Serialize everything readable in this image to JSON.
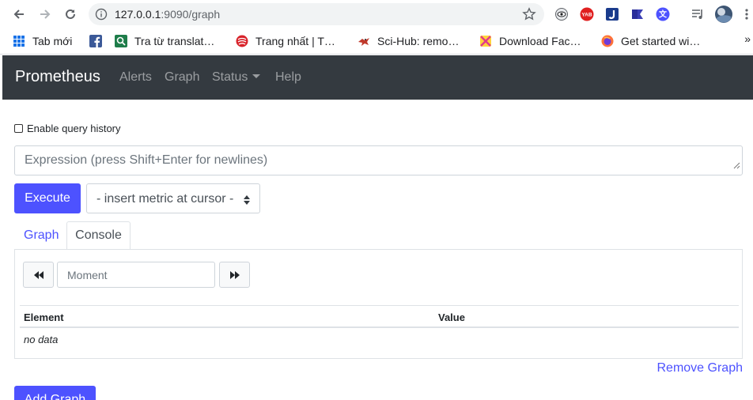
{
  "browser": {
    "url_host": "127.0.0.1",
    "url_rest": ":9090/graph",
    "bookmarks": [
      {
        "label": "Tab mới"
      },
      {
        "label": ""
      },
      {
        "label": "Tra từ translat…"
      },
      {
        "label": "Trang nhất | T…"
      },
      {
        "label": "Sci-Hub: remo…"
      },
      {
        "label": "Download Fac…"
      },
      {
        "label": "Get started wi…"
      }
    ],
    "overflow": "»",
    "extension_badge": "YAB"
  },
  "navbar": {
    "brand": "Prometheus",
    "links": [
      "Alerts",
      "Graph",
      "Status",
      "Help"
    ]
  },
  "query_history": {
    "label": "Enable query history",
    "checked": false
  },
  "expression": {
    "placeholder": "Expression (press Shift+Enter for newlines)"
  },
  "execute_label": "Execute",
  "metric_select": "- insert metric at cursor -",
  "tabs": {
    "graph": "Graph",
    "console": "Console",
    "active": "Console"
  },
  "console": {
    "moment_placeholder": "Moment",
    "columns": [
      "Element",
      "Value"
    ],
    "empty_text": "no data"
  },
  "remove_graph": "Remove Graph",
  "add_graph": "Add Graph",
  "colors": {
    "accent": "#4d52ff",
    "navbar": "#343a40"
  }
}
